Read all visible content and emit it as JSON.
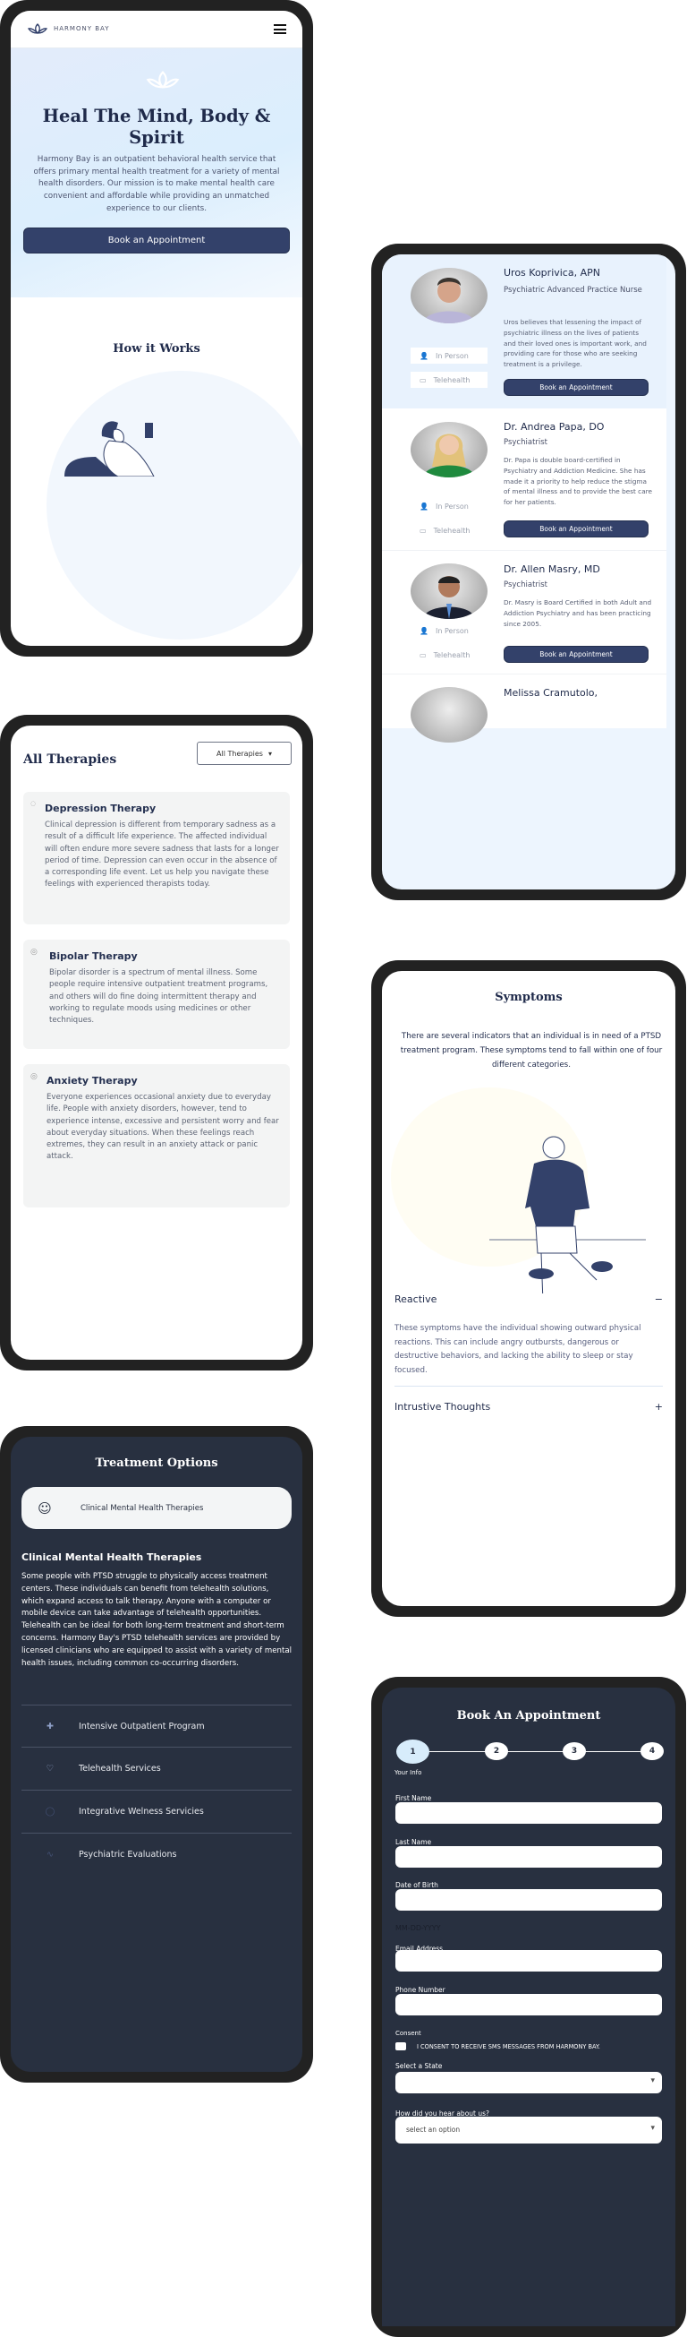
{
  "home": {
    "brand": "HARMONY BAY",
    "hero_title": "Heal The Mind, Body & Spirit",
    "hero_text": "Harmony Bay is an outpatient behavioral health service that offers primary mental health treatment for a variety of mental health disorders. Our mission is to make mental health care convenient and affordable while providing an unmatched experience to our clients.",
    "cta": "Book an Appointment",
    "how_title": "How it Works"
  },
  "providers": {
    "in_person": "In Person",
    "telehealth": "Telehealth",
    "cta": "Book an Appointment",
    "items": [
      {
        "name": "Uros Koprivica, APN",
        "role": "Psychiatric Advanced Practice Nurse",
        "bio": "Uros believes that lessening the impact of psychiatric illness on the lives of patients and their loved ones is important work, and providing care for those who are seeking treatment is a privilege."
      },
      {
        "name": "Dr. Andrea Papa, DO",
        "role": "Psychiatrist",
        "bio": "Dr. Papa is double board-certified in Psychiatry and Addiction Medicine. She has made it a priority to help reduce the stigma of mental illness and to provide the best care for her patients."
      },
      {
        "name": "Dr. Allen Masry, MD",
        "role": "Psychiatrist",
        "bio": "Dr.  Masry is Board Certified in both Adult and Addiction Psychiatry and has been practicing since 2005."
      },
      {
        "name": "Melissa Cramutolo,"
      }
    ]
  },
  "therapies": {
    "title": "All Therapies",
    "filter": "All Therapies",
    "items": [
      {
        "title": "Depression Therapy",
        "text": "Clinical depression is different from temporary sadness as a result of a difficult life experience. The affected individual will often endure more severe sadness that lasts for a longer period of time. Depression can even occur in the absence of a corresponding life event. Let us help you navigate these feelings with experienced therapists today."
      },
      {
        "title": "Bipolar Therapy",
        "text": "Bipolar disorder is a spectrum of mental illness. Some people require intensive outpatient treatment programs, and others will do fine doing intermittent therapy and working to regulate moods using medicines or other techniques."
      },
      {
        "title": "Anxiety Therapy",
        "text": "Everyone experiences occasional anxiety due to everyday life. People with anxiety disorders, however, tend to experience intense, excessive and persistent worry and fear about everyday situations. When these feelings reach extremes, they can result in an anxiety attack or panic attack."
      }
    ]
  },
  "treatment": {
    "title": "Treatment Options",
    "active_tab": "Clinical Mental Health Therapies",
    "heading": "Clinical Mental Health Therapies",
    "text": "Some people with PTSD struggle to physically access treatment centers. These individuals can benefit from telehealth solutions, which expand access to talk therapy. Anyone with a computer or mobile device can take advantage of telehealth opportunities. Telehealth can be ideal for both long-term treatment and short-term concerns. Harmony Bay's PTSD telehealth services are provided by licensed clinicians who are equipped to assist with a variety of mental health issues, including common co-occurring disorders.",
    "options": [
      "Intensive Outpatient Program",
      "Telehealth Services",
      "Integrative Welness Servicies",
      "Psychiatric Evaluations"
    ]
  },
  "symptoms": {
    "title": "Symptoms",
    "intro": "There are several indicators that an individual is in need of a PTSD treatment program. These symptoms tend to fall within one of four different categories.",
    "accordion": [
      {
        "title": "Reactive",
        "toggle": "−",
        "text": "These symptoms have the individual showing outward physical reactions. This can include angry outbursts, dangerous or destructive behaviors, and lacking the ability to sleep or stay focused."
      },
      {
        "title": "Intrustive Thoughts",
        "toggle": "+"
      }
    ]
  },
  "booking": {
    "title": "Book An Appointment",
    "steps": [
      "1",
      "2",
      "3",
      "4"
    ],
    "step_label": "Your Info",
    "first_name": "First Name",
    "last_name": "Last Name",
    "dob": "Date of Birth",
    "dob_hint": "MM-DD-YYYY",
    "email": "Email Address",
    "phone": "Phone Number",
    "consent": "Consent",
    "consent_text": "I CONSENT TO RECEIVE SMS MESSAGES FROM HARMONY BAY.",
    "state": "Select a State",
    "hear": "How did you hear about us?",
    "hear_placeholder": "select an option"
  },
  "colors": {
    "navy": "#33416a",
    "dark": "#283040",
    "light_blue": "#e3f0fd"
  }
}
